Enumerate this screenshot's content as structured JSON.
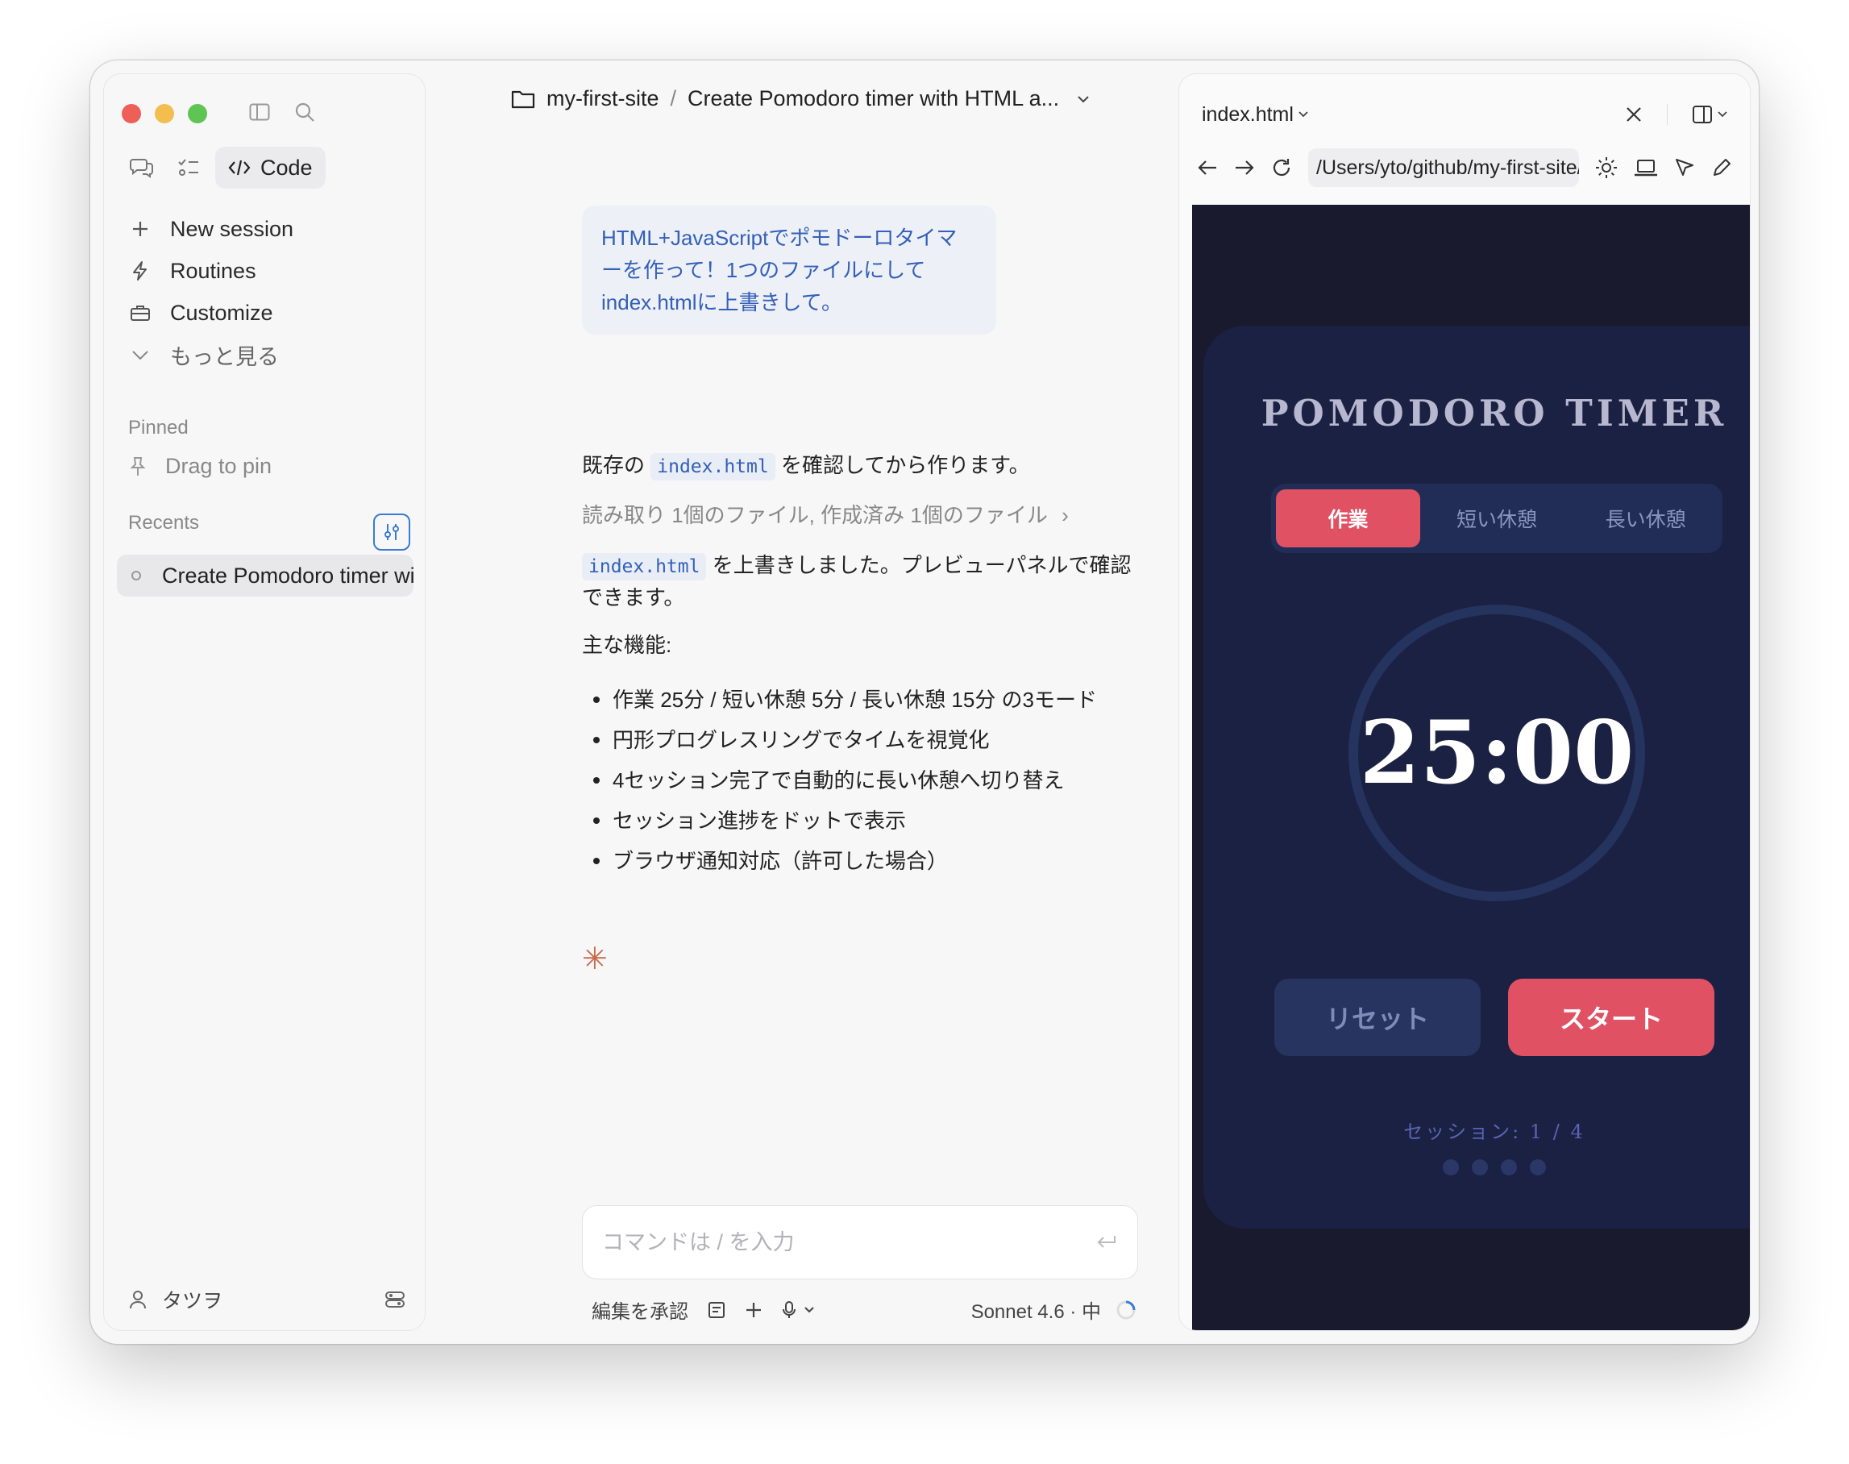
{
  "sidebar": {
    "mode_code_label": "Code",
    "nav": [
      {
        "label": "New session",
        "icon": "plus-icon"
      },
      {
        "label": "Routines",
        "icon": "bolt-icon"
      },
      {
        "label": "Customize",
        "icon": "briefcase-icon"
      },
      {
        "label": "もっと見る",
        "icon": "chevron-down-icon"
      }
    ],
    "pinned_label": "Pinned",
    "pin_placeholder": "Drag to pin",
    "recents_label": "Recents",
    "recents": [
      {
        "label": "Create Pomodoro timer with HTML and JavaScript"
      }
    ],
    "user_name": "タツヲ"
  },
  "chat": {
    "project": "my-first-site",
    "session_title": "Create Pomodoro timer with HTML a...",
    "user_message": "HTML+JavaScriptでポモドーロタイマーを作って！1つのファイルにしてindex.htmlに上書きして。",
    "reply1_pre": "既存の",
    "reply1_code": "index.html",
    "reply1_post": "を確認してから作ります。",
    "tool_summary": "読み取り 1個のファイル, 作成済み 1個のファイル",
    "reply2_code": "index.html",
    "reply2_post": "を上書きしました。プレビューパネルで確認できます。",
    "features_heading": "主な機能:",
    "features": [
      "作業 25分 / 短い休憩 5分 / 長い休憩 15分 の3モード",
      "円形プログレスリングでタイムを視覚化",
      "4セッション完了で自動的に長い休憩へ切り替え",
      "セッション進捗をドットで表示",
      "ブラウザ通知対応（許可した場合）"
    ],
    "input_placeholder": "コマンドは / を入力",
    "accept_edits_label": "編集を承認",
    "model_label": "Sonnet 4.6 · 中"
  },
  "preview": {
    "tab_label": "index.html",
    "url": "/Users/yto/github/my-first-site/index.html",
    "app": {
      "title": "POMODORO TIMER",
      "modes": [
        "作業",
        "短い休憩",
        "長い休憩"
      ],
      "active_mode_index": 0,
      "time": "25:00",
      "reset_label": "リセット",
      "start_label": "スタート",
      "session_text": "セッション: 1 / 4",
      "session_dots_total": 4,
      "progress_fraction": 1.0,
      "colors": {
        "background": "#1a1a2e",
        "card": "#1b2142",
        "accent": "#e05263",
        "ring": "#25335f"
      }
    }
  },
  "colors": {
    "traffic_red": "#ee5f57",
    "traffic_yellow": "#f4bd4f",
    "traffic_green": "#5fc454",
    "link_blue": "#3360b8",
    "star_orange": "#c96a4a"
  }
}
